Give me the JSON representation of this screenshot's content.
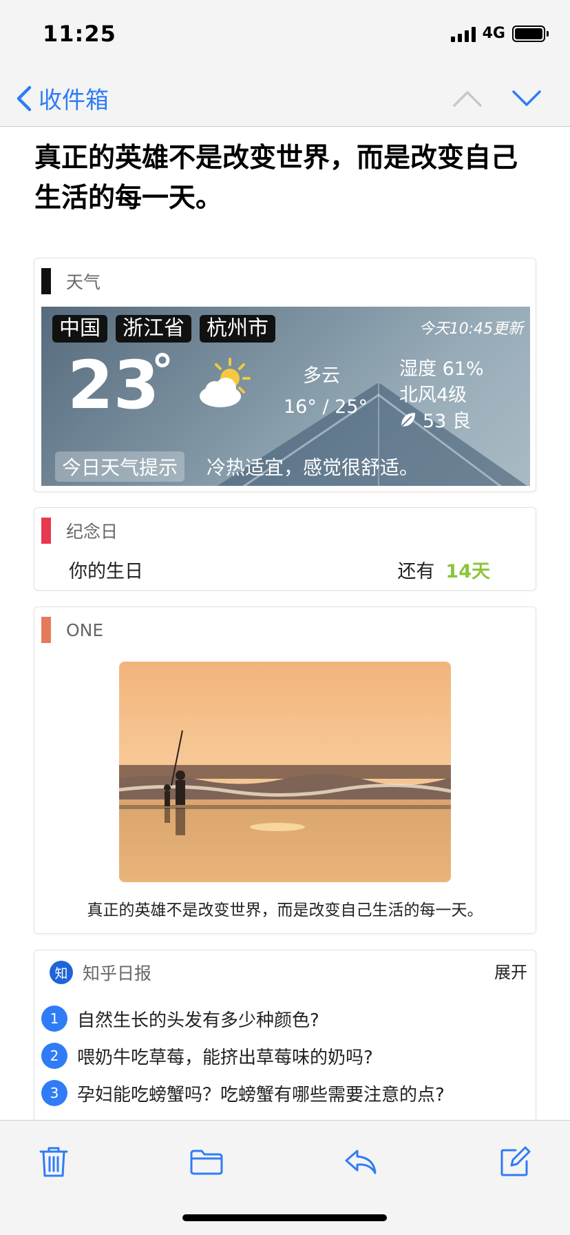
{
  "status": {
    "time": "11:25",
    "network": "4G"
  },
  "nav": {
    "back_label": "收件箱"
  },
  "email": {
    "headline": "真正的英雄不是改变世界，而是改变自己生活的每一天。"
  },
  "weather": {
    "section_title": "天气",
    "accent": "#111111",
    "locations": [
      "中国",
      "浙江省",
      "杭州市"
    ],
    "updated": "今天10:45更新",
    "temperature": "23",
    "degree": "°",
    "condition": "多云",
    "range": "16° / 25°",
    "humidity": "湿度 61%",
    "wind": "北风4级",
    "aqi": "53 良",
    "tip_label": "今日天气提示",
    "tip_text": "冷热适宜，感觉很舒适。"
  },
  "anniversary": {
    "section_title": "纪念日",
    "accent": "#e8384f",
    "name": "你的生日",
    "remain_label": "还有",
    "days": "14天"
  },
  "one": {
    "section_title": "ONE",
    "accent": "#e57a5a",
    "caption": "真正的英雄不是改变世界，而是改变自己生活的每一天。"
  },
  "zhihu": {
    "logo": "知",
    "section_title": "知乎日报",
    "expand": "展开",
    "items": [
      {
        "num": "1",
        "title": "自然生长的头发有多少种颜色?"
      },
      {
        "num": "2",
        "title": "喂奶牛吃草莓，能挤出草莓味的奶吗?"
      },
      {
        "num": "3",
        "title": "孕妇能吃螃蟹吗？吃螃蟹有哪些需要注意的点?"
      }
    ]
  },
  "icons": [
    "chevron-left-icon",
    "chevron-up-icon",
    "chevron-down-icon",
    "trash-icon",
    "folder-icon",
    "reply-icon",
    "compose-icon",
    "partly-cloudy-icon",
    "leaf-icon"
  ],
  "colors": {
    "accent_blue": "#2f7cf6",
    "green": "#8cc43a"
  }
}
